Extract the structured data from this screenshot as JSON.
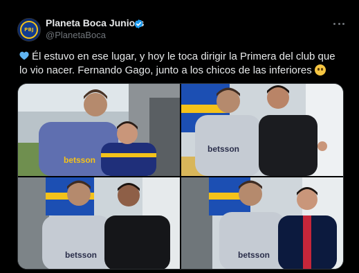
{
  "post": {
    "author_name": "Planeta Boca Juniors",
    "author_handle": "@PlanetaBoca",
    "avatar_text": "PBJ",
    "text": "Él estuvo en ese lugar, y hoy le toca dirigir la Primera del club que lo vio nacer. Fernando Gago, junto a los chicos de las inferiores",
    "photos": [
      {
        "alt": "photo-1",
        "jersey_text": "betsson"
      },
      {
        "alt": "photo-2",
        "jersey_text": "betsson"
      },
      {
        "alt": "photo-3",
        "jersey_text": "betsson"
      },
      {
        "alt": "photo-4",
        "jersey_text": "betsson"
      }
    ]
  },
  "colors": {
    "background": "#000000",
    "text_primary": "#e7e9ea",
    "text_secondary": "#71767b",
    "verified_blue": "#1d9bf0",
    "heart_blue": "#5fb4f2",
    "boca_blue": "#123c8f",
    "boca_gold": "#f4c21a"
  }
}
